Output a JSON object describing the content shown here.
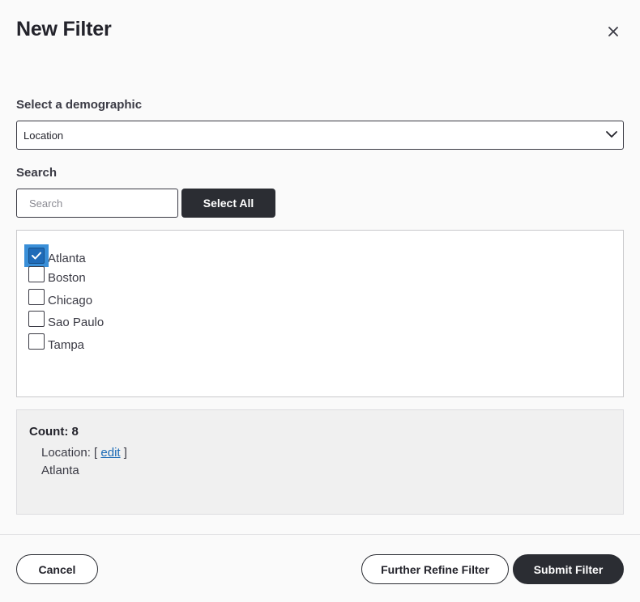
{
  "modal": {
    "title": "New Filter",
    "close_icon": "close-icon"
  },
  "demographic": {
    "label": "Select a demographic",
    "selected": "Location",
    "icon": "chevron-down-icon"
  },
  "search": {
    "label": "Search",
    "placeholder": "Search",
    "value": "",
    "select_all_label": "Select All"
  },
  "options": [
    {
      "label": "Atlanta",
      "checked": true
    },
    {
      "label": "Boston",
      "checked": false
    },
    {
      "label": "Chicago",
      "checked": false
    },
    {
      "label": "Sao Paulo",
      "checked": false
    },
    {
      "label": "Tampa",
      "checked": false
    }
  ],
  "summary": {
    "count_label": "Count: 8",
    "location_prefix": "Location: [",
    "edit_link": "edit",
    "location_suffix": "]",
    "location_value": "Atlanta"
  },
  "footer": {
    "cancel_label": "Cancel",
    "refine_label": "Further Refine Filter",
    "submit_label": "Submit Filter"
  },
  "colors": {
    "primary_dark": "#2b2d33",
    "checkbox_checked": "#1f6bb8",
    "checkbox_focus": "#3a8fd8",
    "link": "#1a6ab5"
  }
}
